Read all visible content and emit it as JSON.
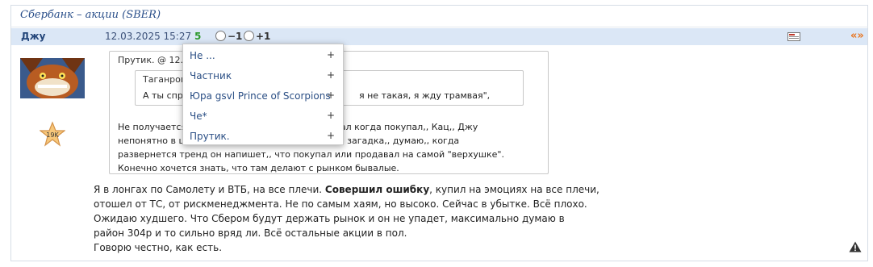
{
  "topic": {
    "title": "Сбербанк – акции (SBER)"
  },
  "post": {
    "author": "Джу",
    "date": "12.03.2025 15:27",
    "score": "5",
    "vote_minus": "−1",
    "vote_plus": "+1",
    "quote_link": "«»",
    "rank": "19K",
    "colors": {
      "header_bg": "#dbe7f6",
      "score": "#2e9a2e",
      "link": "#2b4f85",
      "quote_link": "#e8741e"
    }
  },
  "quote": {
    "header": "Прутик. @ 12.0",
    "inner_header": "Таганрог",
    "inner_text_left": "А ты спр",
    "inner_text_right": "я не такая, я жду трамвая\",",
    "lines": [
      "Не получается                                            вя писал когда покупал,, Кац,, Джу",
      "непонятно в ц                                            вообще загадка,, думаю,, когда",
      "развернется тренд он напишет,, что покупал или продавал на самой \"верхушке\".",
      "Конечно хочется знать, что там делают с рынком бывалые."
    ]
  },
  "body": {
    "line1_pre": "Я в лонгах по Самолету и ВТБ, на все плечи. ",
    "line1_bold": "Совершил ошибку",
    "line1_post": ", купил на эмоциях на все плечи,",
    "lines": [
      "отошел от ТС, от рискменеджмента. Не по самым хаям, но высоко. Сейчас в убытке. Всё плохо.",
      "Ожидаю худшего. Что Сбером будут держать рынок и он не упадет, максимально думаю в",
      "район 304р и то сильно вряд ли. Всё остальные акции в пол.",
      "Говорю честно, как есть."
    ]
  },
  "dropdown": {
    "items": [
      {
        "label": "Не ...",
        "action": "+"
      },
      {
        "label": "Частник",
        "action": "+"
      },
      {
        "label": "Юра gsvl Prince of Scorpions",
        "action": "+"
      },
      {
        "label": "Че*",
        "action": "+"
      },
      {
        "label": "Прутик.",
        "action": "+"
      }
    ]
  },
  "icons": {
    "flag": "flag-icon",
    "warning": "warning-icon",
    "avatar": "avatar-image",
    "rank": "star-badge-icon"
  }
}
